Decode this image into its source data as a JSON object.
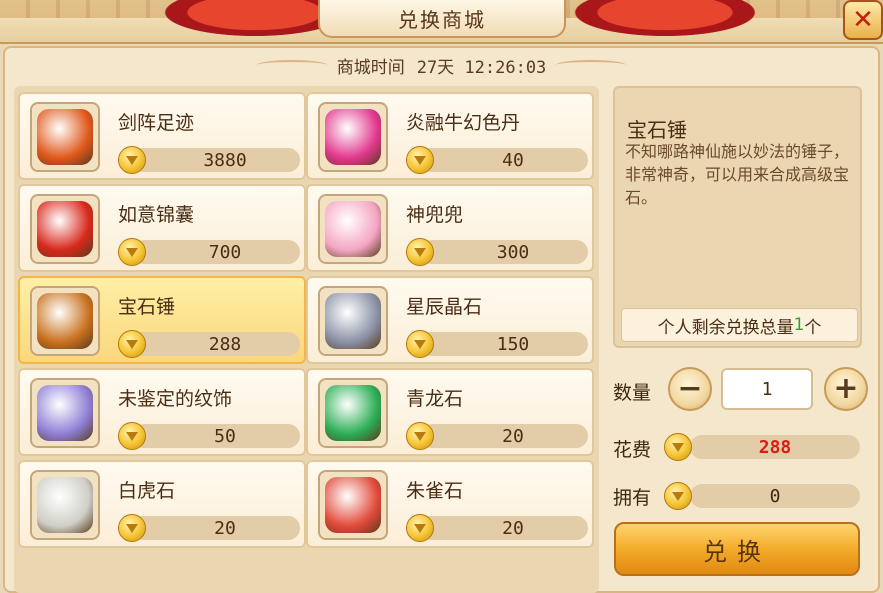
{
  "window": {
    "title": "兑换商城",
    "close_label": "✕"
  },
  "timer": {
    "label": "商城时间",
    "value": "27天  12:26:03"
  },
  "items": [
    {
      "name": "剑阵足迹",
      "price": "3880",
      "icon": "flaming-gem-icon",
      "color": "#e0581b"
    },
    {
      "name": "炎融牛幻色丹",
      "price": "40",
      "icon": "pink-orb-icon",
      "color": "#e2388e"
    },
    {
      "name": "如意锦囊",
      "price": "700",
      "icon": "lucky-bag-icon",
      "color": "#d8281c"
    },
    {
      "name": "神兜兜",
      "price": "300",
      "icon": "pink-pet-icon",
      "color": "#f4a6c2"
    },
    {
      "name": "宝石锤",
      "price": "288",
      "icon": "gem-hammer-icon",
      "color": "#c9711e"
    },
    {
      "name": "星辰晶石",
      "price": "150",
      "icon": "crystal-icon",
      "color": "#8a92a6"
    },
    {
      "name": "未鉴定的纹饰",
      "price": "50",
      "icon": "purple-stone-icon",
      "color": "#8f7fd6"
    },
    {
      "name": "青龙石",
      "price": "20",
      "icon": "azure-dragon-stone-icon",
      "color": "#2cae54"
    },
    {
      "name": "白虎石",
      "price": "20",
      "icon": "white-tiger-stone-icon",
      "color": "#cfcfc7"
    },
    {
      "name": "朱雀石",
      "price": "20",
      "icon": "vermilion-bird-stone-icon",
      "color": "#e24a3a"
    }
  ],
  "selected_index": 4,
  "detail": {
    "title": "宝石锤",
    "description": "不知哪路神仙施以妙法的锤子，非常神奇，可以用来合成高级宝石。",
    "remaining_label_prefix": "个人剩余兑换总量",
    "remaining_count": "1",
    "remaining_label_suffix": "个"
  },
  "quantity": {
    "label": "数量",
    "value": "1",
    "minus": "−",
    "plus": "+"
  },
  "cost": {
    "label": "花费",
    "value": "288"
  },
  "owned": {
    "label": "拥有",
    "value": "0"
  },
  "exchange_button": "兑换",
  "colors": {
    "accent": "#f2a826",
    "cost_red": "#d81f14",
    "remain_green": "#2fa52f"
  }
}
